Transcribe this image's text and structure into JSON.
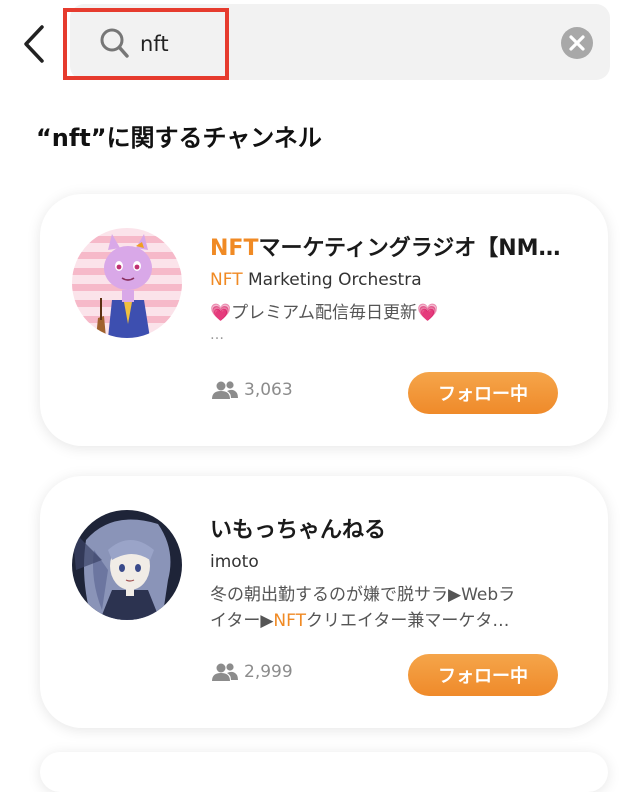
{
  "search": {
    "query": "nft"
  },
  "section": {
    "title": "“nft”に関するチャンネル"
  },
  "channels": [
    {
      "name_highlight": "NFT",
      "name_rest": "マーケティングラジオ【NM…",
      "author_highlight": "NFT",
      "author_rest": " Marketing Orchestra",
      "desc_lines": [
        "💗プレミアム配信毎日更新💗"
      ],
      "desc_more": "…",
      "followers": "3,063",
      "follow_label": "フォロー中"
    },
    {
      "name_highlight": "",
      "name_rest": "いもっちゃんねる",
      "author_highlight": "",
      "author_rest": "imoto",
      "desc_line1": "冬の朝出勤するのが嫌で脱サラ▶Webラ",
      "desc_line2_pre": "イター▶",
      "desc_line2_hl": "NFT",
      "desc_line2_post": "クリエイター兼マーケタ…",
      "followers": "2,999",
      "follow_label": "フォロー中"
    }
  ],
  "colors": {
    "accent": "#f08a24",
    "highlight_box": "#e63b2e",
    "search_bg": "#f2f2f2"
  }
}
